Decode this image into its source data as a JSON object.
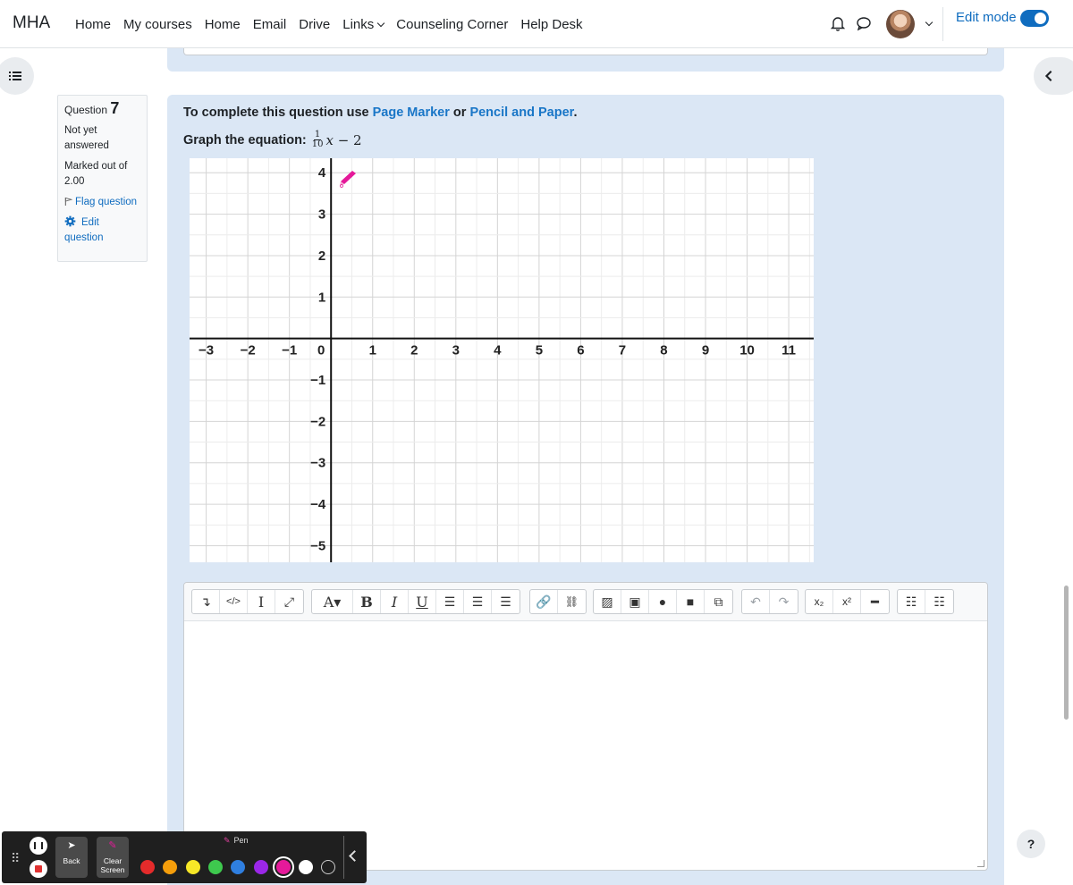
{
  "nav": {
    "brand": "MHA",
    "links": [
      "Home",
      "My courses",
      "Home",
      "Email",
      "Drive",
      "Links",
      "Counseling Corner",
      "Help Desk"
    ],
    "edit_mode_label": "Edit mode"
  },
  "question": {
    "label": "Question",
    "number": "7",
    "status": "Not yet answered",
    "marked": "Marked out of 2.00",
    "flag": "Flag question",
    "edit": "Edit question"
  },
  "content": {
    "instr_prefix": "To complete this question use",
    "link1": "Page Marker",
    "instr_or": "or",
    "link2": "Pencil and Paper",
    "instr_end": ".",
    "eq_label": "Graph the equation:",
    "frac_num": "1",
    "frac_den": "10",
    "eq_var": "x",
    "eq_rest": " − 2"
  },
  "chart_data": {
    "type": "scatter",
    "xlim": [
      -3.4,
      11.6
    ],
    "ylim": [
      -5.4,
      4.35
    ],
    "x_ticks": [
      "−3",
      "−2",
      "−1",
      "0",
      "1",
      "2",
      "3",
      "4",
      "5",
      "6",
      "7",
      "8",
      "9",
      "10",
      "11"
    ],
    "y_ticks": [
      "4",
      "3",
      "2",
      "1",
      "−1",
      "−2",
      "−3",
      "−4",
      "−5"
    ],
    "grid": true,
    "series": []
  },
  "penbar": {
    "back": "Back",
    "clear": "Clear Screen",
    "pen": "Pen",
    "colors": [
      "#e52b2b",
      "#f59e0b",
      "#f7e727",
      "#3ec94e",
      "#2f7fe0",
      "#9b27e8",
      "#e5199a",
      "#ffffff",
      "#1f1f1f"
    ],
    "selected": "#e5199a"
  },
  "help": "?"
}
